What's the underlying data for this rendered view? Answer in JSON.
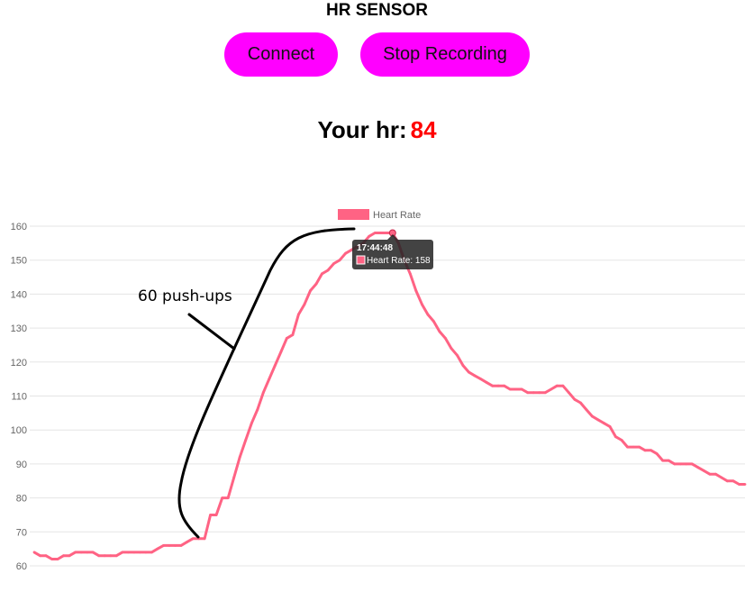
{
  "header": {
    "title": "HR SENSOR"
  },
  "buttons": {
    "connect_label": "Connect",
    "stop_label": "Stop Recording"
  },
  "status": {
    "prefix": "Your hr:",
    "value": "84"
  },
  "colors": {
    "button_bg": "#ff00ff",
    "hr_value": "#ff0000",
    "line": "#ff6384",
    "grid": "#e5e5e5",
    "tooltip_bg": "#222222"
  },
  "chart_data": {
    "type": "line",
    "ylim": [
      60,
      160
    ],
    "yticks": [
      60,
      70,
      80,
      90,
      100,
      110,
      120,
      130,
      140,
      150,
      160
    ],
    "grid": true,
    "legend_position": "top",
    "series": [
      {
        "name": "Heart Rate",
        "color": "#ff6384",
        "values": [
          64,
          63,
          63,
          62,
          62,
          63,
          63,
          64,
          64,
          64,
          64,
          63,
          63,
          63,
          63,
          64,
          64,
          64,
          64,
          64,
          64,
          65,
          66,
          66,
          66,
          66,
          67,
          68,
          68,
          68,
          75,
          75,
          80,
          80,
          86,
          92,
          97,
          102,
          106,
          111,
          115,
          119,
          123,
          127,
          128,
          134,
          137,
          141,
          143,
          146,
          147,
          149,
          150,
          152,
          153,
          154,
          155,
          157,
          158,
          158,
          158,
          158,
          155,
          150,
          146,
          141,
          137,
          134,
          132,
          129,
          127,
          124,
          122,
          119,
          117,
          116,
          115,
          114,
          113,
          113,
          113,
          112,
          112,
          112,
          111,
          111,
          111,
          111,
          112,
          113,
          113,
          111,
          109,
          108,
          106,
          104,
          103,
          102,
          101,
          98,
          97,
          95,
          95,
          95,
          94,
          94,
          93,
          91,
          91,
          90,
          90,
          90,
          90,
          89,
          88,
          87,
          87,
          86,
          85,
          85,
          84,
          84
        ]
      }
    ],
    "tooltip": {
      "title": "17:44:48",
      "label": "Heart Rate: 158",
      "index": 61
    },
    "annotation": "60 push-ups"
  }
}
